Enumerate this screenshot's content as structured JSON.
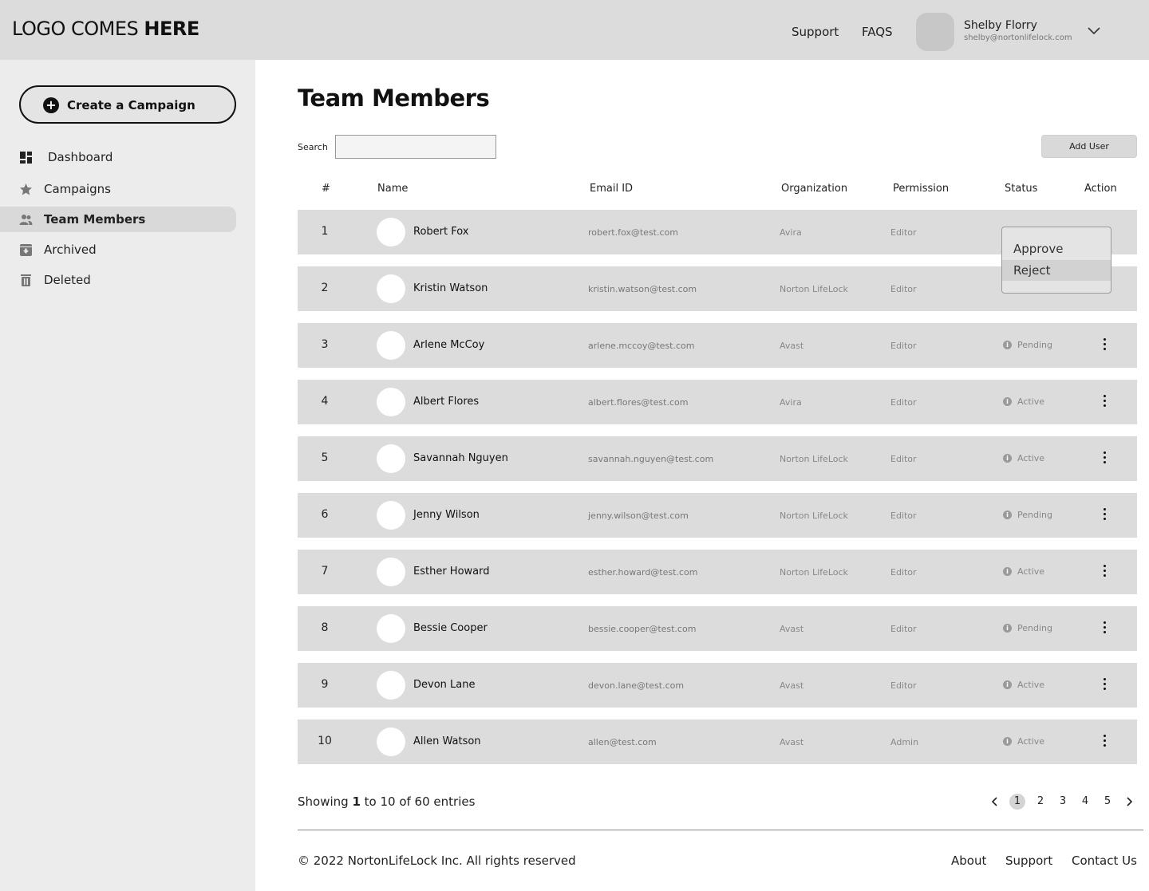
{
  "header": {
    "logo_regular": "LOGO COMES ",
    "logo_bold": "HERE",
    "support": "Support",
    "faqs": "FAQS",
    "user_name": "Shelby Florry",
    "user_email": "shelby@nortonlifelock.com"
  },
  "sidebar": {
    "create_label": "Create a Campaign",
    "items": [
      {
        "label": "Dashboard",
        "icon": "dashboard-icon"
      },
      {
        "label": "Campaigns",
        "icon": "star-icon"
      },
      {
        "label": "Team Members",
        "icon": "people-icon",
        "active": true
      },
      {
        "label": "Archived",
        "icon": "archive-icon"
      },
      {
        "label": "Deleted",
        "icon": "trash-icon"
      }
    ]
  },
  "main": {
    "title": "Team Members",
    "search_label": "Search",
    "search_value": "",
    "add_user": "Add User",
    "columns": [
      "#",
      "Name",
      "Email ID",
      "Organization",
      "Permission",
      "Status",
      "Action"
    ],
    "rows": [
      {
        "num": "1",
        "name": "Robert Fox",
        "email": "robert.fox@test.com",
        "org": "Avira",
        "perm": "Editor",
        "status": ""
      },
      {
        "num": "2",
        "name": "Kristin Watson",
        "email": "kristin.watson@test.com",
        "org": "Norton LifeLock",
        "perm": "Editor",
        "status": ""
      },
      {
        "num": "3",
        "name": "Arlene McCoy",
        "email": "arlene.mccoy@test.com",
        "org": "Avast",
        "perm": "Editor",
        "status": "Pending"
      },
      {
        "num": "4",
        "name": "Albert Flores",
        "email": "albert.flores@test.com",
        "org": "Avira",
        "perm": "Editor",
        "status": "Active"
      },
      {
        "num": "5",
        "name": "Savannah Nguyen",
        "email": "savannah.nguyen@test.com",
        "org": "Norton LifeLock",
        "perm": "Editor",
        "status": "Active"
      },
      {
        "num": "6",
        "name": "Jenny Wilson",
        "email": "jenny.wilson@test.com",
        "org": "Norton LifeLock",
        "perm": "Editor",
        "status": "Pending"
      },
      {
        "num": "7",
        "name": "Esther Howard",
        "email": "esther.howard@test.com",
        "org": "Norton LifeLock",
        "perm": "Editor",
        "status": "Active"
      },
      {
        "num": "8",
        "name": "Bessie Cooper",
        "email": "bessie.cooper@test.com",
        "org": "Avast",
        "perm": "Editor",
        "status": "Pending"
      },
      {
        "num": "9",
        "name": "Devon Lane",
        "email": "devon.lane@test.com",
        "org": "Avast",
        "perm": "Editor",
        "status": "Active"
      },
      {
        "num": "10",
        "name": "Allen Watson",
        "email": "allen@test.com",
        "org": "Avast",
        "perm": "Admin",
        "status": "Active"
      }
    ],
    "action_menu": [
      "Approve",
      "Reject"
    ]
  },
  "pagination": {
    "showing_prefix": "Showing ",
    "showing_start": "1",
    "showing_suffix": " to 10 of 60 entries",
    "pages": [
      "1",
      "2",
      "3",
      "4",
      "5"
    ],
    "current_page": "1"
  },
  "footer": {
    "copyright": "© 2022 NortonLifeLock Inc. All rights reserved",
    "links": [
      "About",
      "Support",
      "Contact Us"
    ]
  },
  "colors": {
    "header_bg": "#dcdcdc",
    "sidebar_bg": "#ececec",
    "row_bg": "#dcdcdc"
  }
}
